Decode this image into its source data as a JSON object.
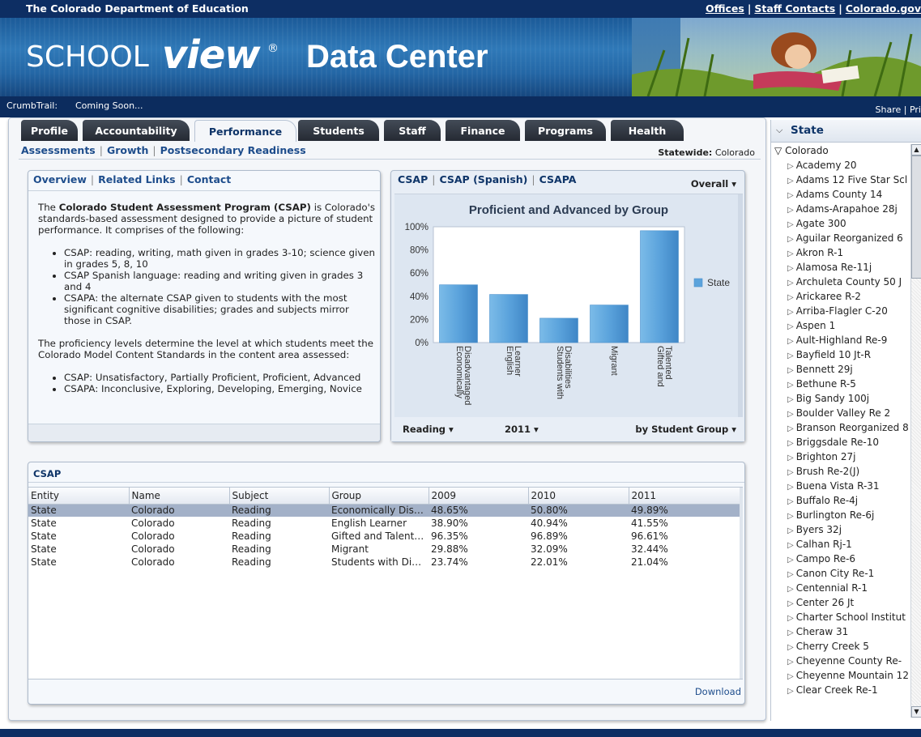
{
  "header": {
    "org_name": "The Colorado Department of Education",
    "links": [
      "Offices",
      "Staff Contacts",
      "Colorado.gov"
    ],
    "logo_school": "SCHOOL",
    "logo_view": "view",
    "logo_reg": "®",
    "title": "Data Center"
  },
  "crumb": {
    "label": "CrumbTrail:",
    "value": "Coming Soon...",
    "share": "Share",
    "print": "Pri"
  },
  "tabs": [
    "Profile",
    "Accountability",
    "Performance",
    "Students",
    "Staff",
    "Finance",
    "Programs",
    "Health"
  ],
  "active_tab": "Performance",
  "subnav": [
    "Assessments",
    "Growth",
    "Postsecondary Readiness"
  ],
  "statewide": {
    "label": "Statewide:",
    "value": "Colorado"
  },
  "overview": {
    "tabs": [
      "Overview",
      "Related Links",
      "Contact"
    ],
    "intro_pre": "The ",
    "intro_bold": "Colorado Student Assessment Program (CSAP)",
    "intro_post": " is Colorado's standards-based assessment designed to provide a picture of student performance. It comprises of the following:",
    "bullets1": [
      "CSAP: reading, writing, math given in grades 3-10; science given in grades 5, 8, 10",
      "CSAP Spanish language: reading and writing given in grades 3 and 4",
      "CSAPA: the alternate CSAP given to students with the most significant cognitive disabilities; grades and subjects mirror those in CSAP."
    ],
    "para2": "The proficiency levels determine the level at which students meet the Colorado Model Content Standards in the content area assessed:",
    "bullets2": [
      "CSAP: Unsatisfactory, Partially Proficient, Proficient, Advanced",
      "CSAPA: Inconclusive, Exploring, Developing, Emerging, Novice"
    ]
  },
  "chart_panel": {
    "tabs": [
      "CSAP",
      "CSAP (Spanish)",
      "CSAPA"
    ],
    "overall": "Overall",
    "reading": "Reading",
    "year": "2011",
    "group": "by Student Group"
  },
  "chart_data": {
    "type": "bar",
    "title": "Proficient and Advanced by Group",
    "categories": [
      "Economically Disadvantaged",
      "English Learner",
      "Students with Disabilities",
      "Migrant",
      "Gifted and Talented"
    ],
    "category_lines": [
      [
        "Economically",
        "Disadvantaged"
      ],
      [
        "English",
        "Learner"
      ],
      [
        "Students with",
        "Disabilities"
      ],
      [
        "Migrant"
      ],
      [
        "Gifted and",
        "Talented"
      ]
    ],
    "series": [
      {
        "name": "State",
        "values": [
          49.89,
          41.55,
          21.04,
          32.44,
          96.61
        ]
      }
    ],
    "y_ticks": [
      "0%",
      "20%",
      "40%",
      "60%",
      "80%",
      "100%"
    ],
    "ylim": [
      0,
      100
    ],
    "color": "#5ba3dc",
    "legend_position": "right"
  },
  "table": {
    "title": "CSAP",
    "columns": [
      "Entity",
      "Name",
      "Subject",
      "Group",
      "2009",
      "2010",
      "2011"
    ],
    "rows": [
      [
        "State",
        "Colorado",
        "Reading",
        "Economically Disad...",
        "48.65%",
        "50.80%",
        "49.89%"
      ],
      [
        "State",
        "Colorado",
        "Reading",
        "English Learner",
        "38.90%",
        "40.94%",
        "41.55%"
      ],
      [
        "State",
        "Colorado",
        "Reading",
        "Gifted and Talented",
        "96.35%",
        "96.89%",
        "96.61%"
      ],
      [
        "State",
        "Colorado",
        "Reading",
        "Migrant",
        "29.88%",
        "32.09%",
        "32.44%"
      ],
      [
        "State",
        "Colorado",
        "Reading",
        "Students with Disa...",
        "23.74%",
        "22.01%",
        "21.04%"
      ]
    ],
    "download": "Download"
  },
  "state_panel": {
    "title": "State",
    "root": "Colorado",
    "items": [
      "Academy 20",
      "Adams 12 Five Star Scl",
      "Adams County 14",
      "Adams-Arapahoe 28j",
      "Agate 300",
      "Aguilar Reorganized 6",
      "Akron R-1",
      "Alamosa Re-11j",
      "Archuleta County 50 J",
      "Arickaree R-2",
      "Arriba-Flagler C-20",
      "Aspen 1",
      "Ault-Highland Re-9",
      "Bayfield 10 Jt-R",
      "Bennett 29j",
      "Bethune R-5",
      "Big Sandy 100j",
      "Boulder Valley Re 2",
      "Branson Reorganized 8",
      "Briggsdale Re-10",
      "Brighton 27j",
      "Brush Re-2(J)",
      "Buena Vista R-31",
      "Buffalo Re-4j",
      "Burlington Re-6j",
      "Byers 32j",
      "Calhan Rj-1",
      "Campo Re-6",
      "Canon City Re-1",
      "Centennial R-1",
      "Center 26 Jt",
      "Charter School Institut",
      "Cheraw 31",
      "Cherry Creek 5",
      "Cheyenne County Re-",
      "Cheyenne Mountain 12",
      "Clear Creek Re-1"
    ]
  }
}
